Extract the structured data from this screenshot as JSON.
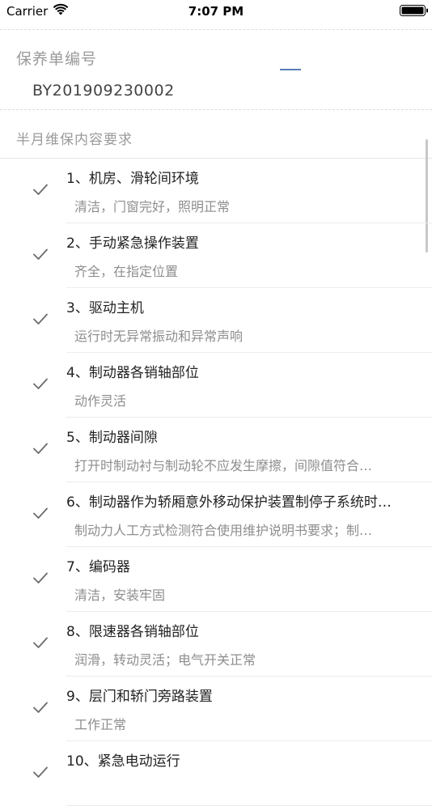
{
  "status_bar": {
    "carrier": "Carrier",
    "time": "7:07 PM"
  },
  "order": {
    "label": "保养单编号",
    "number": "BY201909230002"
  },
  "section": {
    "title": "半月维保内容要求"
  },
  "colors": {
    "accent": "#5b7fb3",
    "check": "#6b6b6b",
    "label_gray": "#9a9a9a"
  },
  "items": [
    {
      "title": "1、机房、滑轮间环境",
      "desc": "清洁，门窗完好，照明正常",
      "checked": true
    },
    {
      "title": "2、手动紧急操作装置",
      "desc": "齐全，在指定位置",
      "checked": true
    },
    {
      "title": "3、驱动主机",
      "desc": "运行时无异常振动和异常声响",
      "checked": true
    },
    {
      "title": "4、制动器各销轴部位",
      "desc": "动作灵活",
      "checked": true
    },
    {
      "title": "5、制动器间隙",
      "desc": "打开时制动衬与制动轮不应发生摩擦，间隙值符合…",
      "checked": true
    },
    {
      "title": "6、制动器作为轿厢意外移动保护装置制停子系统时…",
      "desc": "制动力人工方式检测符合使用维护说明书要求；制…",
      "checked": true
    },
    {
      "title": "7、编码器",
      "desc": "清洁，安装牢固",
      "checked": true
    },
    {
      "title": "8、限速器各销轴部位",
      "desc": "润滑，转动灵活；电气开关正常",
      "checked": true
    },
    {
      "title": "9、层门和轿门旁路装置",
      "desc": "工作正常",
      "checked": true
    },
    {
      "title": "10、紧急电动运行",
      "desc": "",
      "checked": true
    }
  ]
}
